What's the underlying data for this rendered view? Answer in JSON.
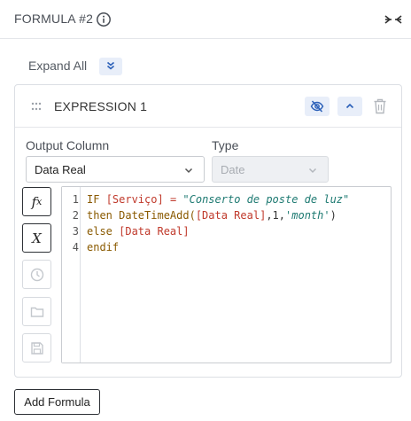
{
  "header": {
    "title": "FORMULA #2"
  },
  "expand_all_label": "Expand All",
  "expression": {
    "title": "EXPRESSION 1",
    "output_column_label": "Output Column",
    "output_column_value": "Data Real",
    "type_label": "Type",
    "type_value": "Date"
  },
  "toolbar_icons": [
    "function-icon",
    "variable-icon",
    "clock-icon",
    "folder-icon",
    "save-icon"
  ],
  "editor": {
    "line_numbers": [
      "1",
      "2",
      "3",
      "4"
    ],
    "line1": {
      "kw": "IF ",
      "field": "[Serviço]",
      "op": " = ",
      "str": "\"Conserto de poste de luz\""
    },
    "line2": {
      "kw": "then DateTimeAdd(",
      "field": "[Data Real]",
      "sep1": ",",
      "num": "1",
      "sep2": ",",
      "str": "'month'",
      "close": ")"
    },
    "line3": {
      "kw": "else ",
      "field": "[Data Real]"
    },
    "line4": {
      "kw": "endif"
    }
  },
  "add_formula_label": "Add Formula",
  "colors": {
    "accent_bg": "#e8eef9",
    "accent_icon": "#2a5fb8",
    "field": "#c0392b",
    "string": "#1e7a72",
    "keyword": "#8a5a00"
  }
}
